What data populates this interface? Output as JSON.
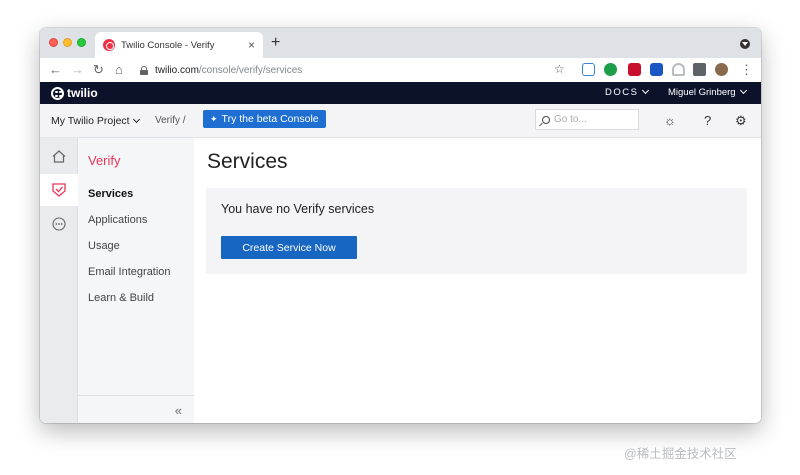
{
  "browser": {
    "tab_title": "Twilio Console - Verify",
    "tab_close": "×",
    "new_tab": "+",
    "url_host": "twilio.com",
    "url_path": "/console/verify/services",
    "back": "←",
    "forward": "→",
    "reload": "↻",
    "home": "⌂",
    "bookmark_star": "☆",
    "menu": "⋮"
  },
  "twilio_bar": {
    "logo_text": "twilio",
    "docs_label": "DOCS",
    "user_name": "Miguel Grinberg"
  },
  "project_bar": {
    "project_name": "My Twilio Project",
    "breadcrumb": "Verify /",
    "beta_button": "Try the beta Console",
    "search_placeholder": "Go to...",
    "bug_icon": "☼",
    "help_icon": "?",
    "settings_icon": "⚙"
  },
  "sidebar": {
    "title": "Verify",
    "items": [
      {
        "label": "Services",
        "active": true
      },
      {
        "label": "Applications",
        "active": false
      },
      {
        "label": "Usage",
        "active": false
      },
      {
        "label": "Email Integration",
        "active": false
      },
      {
        "label": "Learn & Build",
        "active": false
      }
    ],
    "collapse": "«"
  },
  "main": {
    "title": "Services",
    "empty_message": "You have no Verify services",
    "create_button": "Create Service Now"
  },
  "watermark": "@稀土掘金技术社区",
  "colors": {
    "twilio_nav": "#0d122b",
    "accent_red": "#e8365a",
    "button_blue": "#1766c1",
    "beta_blue": "#1f6fd3"
  }
}
